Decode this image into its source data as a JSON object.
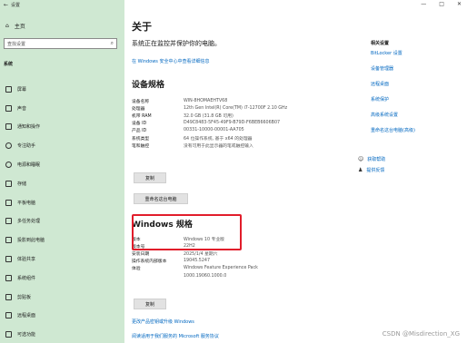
{
  "window": {
    "title": "设置",
    "back_glyph": "←",
    "controls": [
      "—",
      "□",
      "✕"
    ]
  },
  "sidebar": {
    "home_label": "主页",
    "search_placeholder": "查找设置",
    "section_label": "系统",
    "items": [
      {
        "label": "屏幕",
        "icon": "display-icon"
      },
      {
        "label": "声音",
        "icon": "speaker-icon"
      },
      {
        "label": "通知和操作",
        "icon": "notification-icon"
      },
      {
        "label": "专注助手",
        "icon": "moon-icon"
      },
      {
        "label": "电源和睡眠",
        "icon": "power-icon"
      },
      {
        "label": "存储",
        "icon": "storage-icon"
      },
      {
        "label": "平板电脑",
        "icon": "tablet-icon"
      },
      {
        "label": "多任务处理",
        "icon": "multitask-icon"
      },
      {
        "label": "投影到此电脑",
        "icon": "project-icon"
      },
      {
        "label": "体验共享",
        "icon": "share-icon"
      },
      {
        "label": "系统组件",
        "icon": "components-icon"
      },
      {
        "label": "剪贴板",
        "icon": "clipboard-icon"
      },
      {
        "label": "远程桌面",
        "icon": "remote-icon"
      },
      {
        "label": "可选功能",
        "icon": "optional-features-icon"
      }
    ]
  },
  "main": {
    "title": "关于",
    "subtitle": "系统正在监控并保护你的电脑。",
    "security_link": "在 Windows 安全中心中查看详细信息",
    "device_spec_heading": "设备规格",
    "device_specs": [
      {
        "k": "设备名称",
        "v": "WIN-8HOMAEHTV68"
      },
      {
        "k": "处理器",
        "v": "12th Gen Intel(R) Core(TM) i7-12700F   2.10 GHz"
      },
      {
        "k": "机带 RAM",
        "v": "32.0 GB (31.8 GB 可用)"
      },
      {
        "k": "设备 ID",
        "v": "D49C8483-5F45-49F9-B79D-F6BEB6606B07"
      },
      {
        "k": "产品 ID",
        "v": "00331-10000-00001-AA705"
      },
      {
        "k": "系统类型",
        "v": "64 位操作系统, 基于 x64 的处理器"
      },
      {
        "k": "笔和触控",
        "v": "没有可用于此显示器的笔或触控输入"
      }
    ],
    "copy_label": "复制",
    "rename_label": "重命名这台电脑",
    "windows_spec_heading": "Windows 规格",
    "windows_specs": [
      {
        "k": "版本",
        "v": "Windows 10 专业版"
      },
      {
        "k": "版本号",
        "v": "22H2"
      },
      {
        "k": "安装日期",
        "v": "2025/1/4 星期六"
      },
      {
        "k": "操作系统内部版本",
        "v": "19045.5247"
      },
      {
        "k": "体验",
        "v": "Windows Feature Experience Pack"
      },
      {
        "k": "",
        "v": "1000.19060.1000.0"
      }
    ],
    "copy2_label": "复制",
    "bottom_links": [
      "更改产品密钥或升级 Windows",
      "阅读适用于我们服务的 Microsoft 服务协议"
    ]
  },
  "related": {
    "heading": "相关设置",
    "links": [
      "BitLocker 设置",
      "设备管理器",
      "远程桌面",
      "系统保护",
      "高级系统设置",
      "重命名这台电脑(高级)"
    ],
    "help": [
      {
        "label": "获取帮助",
        "icon": "help-icon"
      },
      {
        "label": "提供反馈",
        "icon": "feedback-icon"
      }
    ]
  },
  "watermark": "CSDN @Misdirection_XG",
  "colors": {
    "sidebar_bg": "#cfe8d2",
    "link": "#0067c0",
    "highlight": "#e11d2b"
  }
}
